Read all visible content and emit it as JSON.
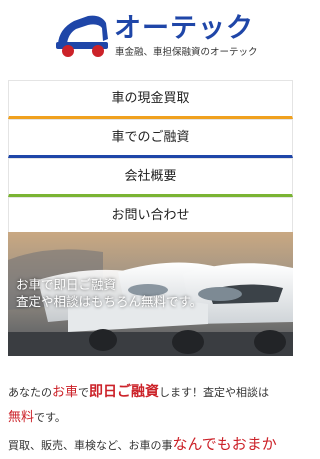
{
  "header": {
    "logo_name": "オーテック",
    "logo_tagline": "車金融、車担保融資のオーテック",
    "colors": {
      "brand_blue": "#1f46a8",
      "brand_red": "#cc2229"
    }
  },
  "nav": {
    "items": [
      {
        "label": "車の現金買取",
        "accent": "#f0a11f"
      },
      {
        "label": "車でのご融資",
        "accent": "#1f46a8"
      },
      {
        "label": "会社概要",
        "accent": "#7ab433"
      },
      {
        "label": "お問い合わせ",
        "accent": "#cc2229"
      }
    ]
  },
  "hero": {
    "line1": "お車で即日ご融資",
    "line2": "査定や相談はもちろん無料です。"
  },
  "intro": {
    "p1_a": "あなたの",
    "p1_b": "お車",
    "p1_c": "で",
    "p1_d": "即日ご融資",
    "p1_e": "します！査定や相談は",
    "p2_a": "無料",
    "p2_b": "です。",
    "p3_a": "買取、販売、車検など、お車の事",
    "p3_b": "なんでもおまか"
  }
}
